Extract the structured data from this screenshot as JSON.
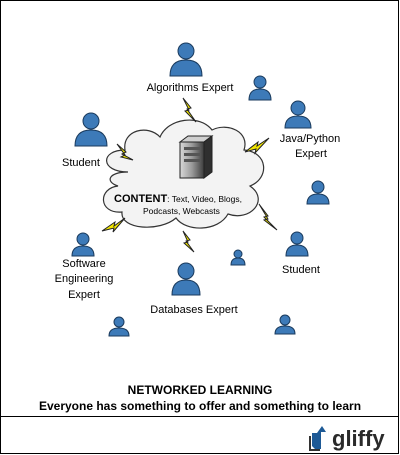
{
  "diagram": {
    "labels": {
      "algorithms": "Algorithms Expert",
      "java_line1": "Java/Python",
      "java_line2": "Expert",
      "student_left": "Student",
      "student_right": "Student",
      "soft_line1": "Software",
      "soft_line2": "Engineering",
      "soft_line3": "Expert",
      "databases": "Databases Expert"
    },
    "content": {
      "heading": "CONTENT",
      "line1_rest": ": Text, Video, Blogs,",
      "line2": "Podcasts, Webcasts"
    },
    "colors": {
      "person_fill": "#3d7ab8",
      "person_stroke": "#1a3a5c",
      "lightning_fill": "#f2e600",
      "cloud_fill": "#f3f3f3"
    }
  },
  "caption": {
    "title": "NETWORKED LEARNING",
    "subtitle": "Everyone has something to offer and something to learn"
  },
  "logo": {
    "text": "gliffy"
  }
}
